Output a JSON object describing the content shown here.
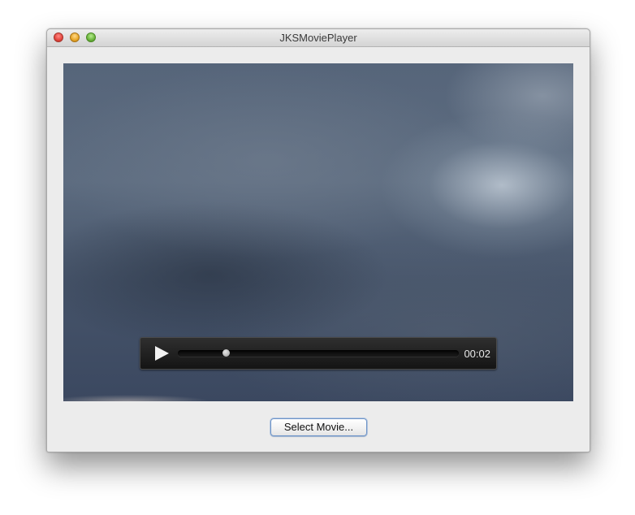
{
  "window": {
    "title": "JKSMoviePlayer"
  },
  "player": {
    "time_label": "00:02",
    "playback_fraction": 0.17,
    "play_icon": "play-icon"
  },
  "actions": {
    "select_movie_label": "Select Movie..."
  },
  "colors": {
    "close": "#e3453d",
    "minimize": "#e8a627",
    "zoom": "#6ab43c",
    "button_focus": "#6d94c8"
  }
}
